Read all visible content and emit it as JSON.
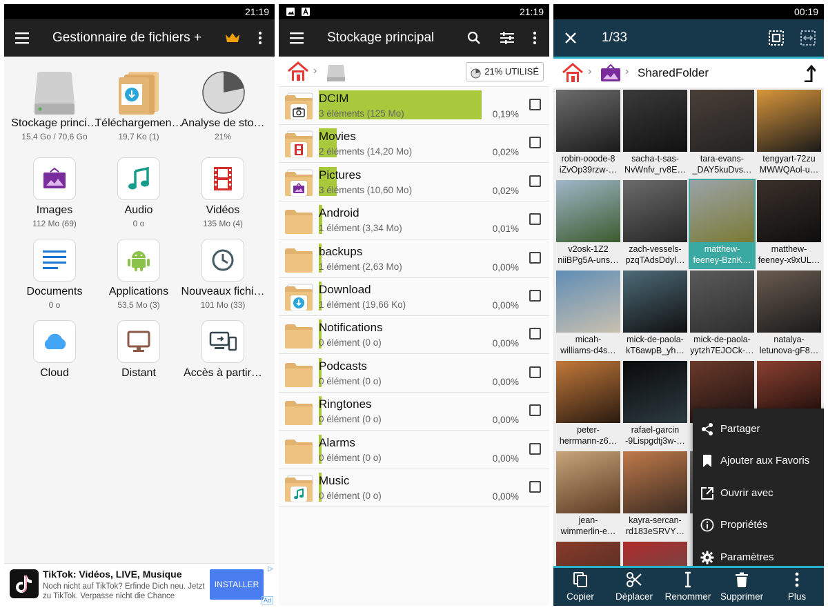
{
  "panel1": {
    "status_time": "21:19",
    "title": "Gestionnaire de fichiers +",
    "items": [
      {
        "label": "Stockage princi…",
        "sub": "15,4 Go / 70,6 Go"
      },
      {
        "label": "Téléchargemen…",
        "sub": "19,7 Ko (1)"
      },
      {
        "label": "Analyse de sto…",
        "sub": "21%"
      },
      {
        "label": "Images",
        "sub": "112 Mo (69)"
      },
      {
        "label": "Audio",
        "sub": "0 o"
      },
      {
        "label": "Vidéos",
        "sub": "135 Mo (4)"
      },
      {
        "label": "Documents",
        "sub": "0 o"
      },
      {
        "label": "Applications",
        "sub": "53,5 Mo (3)"
      },
      {
        "label": "Nouveaux fichi…",
        "sub": "101 Mo (33)"
      },
      {
        "label": "Cloud",
        "sub": ""
      },
      {
        "label": "Distant",
        "sub": ""
      },
      {
        "label": "Accès à partir…",
        "sub": ""
      }
    ],
    "ad": {
      "title": "TikTok: Vidéos, LIVE, Musique",
      "text": "Noch nicht auf TikTok? Erfinde Dich neu. Jetzt zu TikTok. Verpasse nicht die Chance",
      "button": "INSTALLER",
      "tag": "Ad"
    }
  },
  "panel2": {
    "status_time": "21:19",
    "title": "Stockage principal",
    "usage": "21% UTILISÉ",
    "rows": [
      {
        "name": "DCIM",
        "meta": "3 éléments (125 Mo)",
        "pct": "0,19%",
        "fill": 0.19,
        "badge": "camera"
      },
      {
        "name": "Movies",
        "meta": "2 éléments (14,20 Mo)",
        "pct": "0,02%",
        "fill": 0.02,
        "badge": "film"
      },
      {
        "name": "Pictures",
        "meta": "3 éléments (10,60 Mo)",
        "pct": "0,02%",
        "fill": 0.02,
        "badge": "picture"
      },
      {
        "name": "Android",
        "meta": "1 élément (3,34 Mo)",
        "pct": "0,01%",
        "fill": 0.01,
        "badge": ""
      },
      {
        "name": "backups",
        "meta": "1 élément (2,63 Mo)",
        "pct": "0,00%",
        "fill": 0.0,
        "badge": ""
      },
      {
        "name": "Download",
        "meta": "1 élément (19,66 Ko)",
        "pct": "0,00%",
        "fill": 0.0,
        "badge": "download"
      },
      {
        "name": "Notifications",
        "meta": "0 élément (0 o)",
        "pct": "0,00%",
        "fill": 0.0,
        "badge": ""
      },
      {
        "name": "Podcasts",
        "meta": "0 élément (0 o)",
        "pct": "0,00%",
        "fill": 0.0,
        "badge": ""
      },
      {
        "name": "Ringtones",
        "meta": "0 élément (0 o)",
        "pct": "0,00%",
        "fill": 0.0,
        "badge": ""
      },
      {
        "name": "Alarms",
        "meta": "0 élément (0 o)",
        "pct": "0,00%",
        "fill": 0.0,
        "badge": ""
      },
      {
        "name": "Music",
        "meta": "0 élément (0 o)",
        "pct": "0,00%",
        "fill": 0.0,
        "badge": "music"
      }
    ]
  },
  "panel3": {
    "status_time": "00:19",
    "counter": "1/33",
    "folder": "SharedFolder",
    "thumbs": [
      {
        "cap": "robin-ooode-8 iZvOp39rzw-…",
        "tone": [
          "#6d6d6d",
          "#1a1a1a"
        ]
      },
      {
        "cap": "sacha-t-sas- NvWnfv_rv8E…",
        "tone": [
          "#3a3a3a",
          "#111111"
        ]
      },
      {
        "cap": "tara-evans- _DAY5kuDvs…",
        "tone": [
          "#4a3f38",
          "#222222"
        ]
      },
      {
        "cap": "tengyart-72zu MWWQAol-u…",
        "tone": [
          "#d9963a",
          "#1a1a1a"
        ]
      },
      {
        "cap": "v2osk-1Z2 niiBPg5A-uns…",
        "tone": [
          "#9fb7c9",
          "#3c5a2e"
        ]
      },
      {
        "cap": "zach-vessels- pzqTAdsDdyl…",
        "tone": [
          "#6b6b6b",
          "#252525"
        ]
      },
      {
        "cap": "matthew- feeney-BznK…",
        "tone": [
          "#9aa3a8",
          "#7a7a34"
        ]
      },
      {
        "cap": "matthew- feeney-x9xUL…",
        "tone": [
          "#3a302a",
          "#0e0e0e"
        ]
      },
      {
        "cap": "micah- williams-d4s…",
        "tone": [
          "#5f8db5",
          "#c9c0b0"
        ]
      },
      {
        "cap": "mick-de-paola- kT6awpB_yh…",
        "tone": [
          "#4d6b78",
          "#101010"
        ]
      },
      {
        "cap": "mick-de-paola- yytzh7EJOCk-…",
        "tone": [
          "#5a5a5a",
          "#2e2e2e"
        ]
      },
      {
        "cap": "natalya- letunova-gF8…",
        "tone": [
          "#6a5b50",
          "#1a1a1a"
        ]
      },
      {
        "cap": "peter- herrmann-z6…",
        "tone": [
          "#c2793a",
          "#2a1a10"
        ]
      },
      {
        "cap": "rafael-garcin -9Lispgdtj3w-…",
        "tone": [
          "#0a0a0a",
          "#2c3a40"
        ]
      },
      {
        "cap": "",
        "tone": [
          "#6a3a2a",
          "#1a1010"
        ]
      },
      {
        "cap": "",
        "tone": [
          "#8a4030",
          "#150a08"
        ]
      },
      {
        "cap": "jean- wimmerlin-e…",
        "tone": [
          "#c8a57a",
          "#5a3a22"
        ]
      },
      {
        "cap": "kayra-sercan- rd183eSRVY…",
        "tone": [
          "#c07a4a",
          "#3a2a22"
        ]
      },
      {
        "cap": "",
        "tone": [
          "#777777",
          "#333333"
        ]
      },
      {
        "cap": "",
        "tone": [
          "#777777",
          "#333333"
        ]
      },
      {
        "cap": "",
        "tone": [
          "#8a3a2a",
          "#3a2a22"
        ]
      },
      {
        "cap": "",
        "tone": [
          "#b02a2a",
          "#555555"
        ]
      }
    ],
    "menu": [
      "Partager",
      "Ajouter aux Favoris",
      "Ouvrir avec",
      "Propriétés",
      "Paramètres"
    ],
    "bottom": [
      "Copier",
      "Déplacer",
      "Renommer",
      "Supprimer",
      "Plus"
    ]
  }
}
